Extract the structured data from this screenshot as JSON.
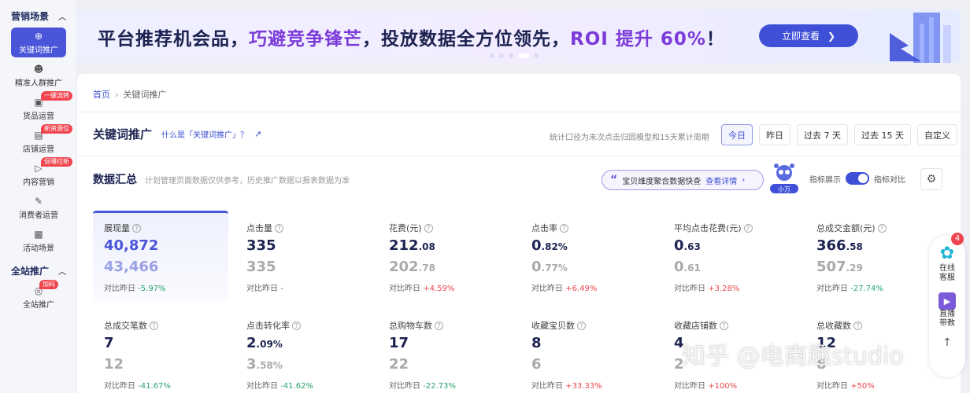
{
  "sidebar": {
    "group1": "营销场景",
    "items": [
      {
        "label": "关键词推广",
        "icon": "target-icon",
        "active": true,
        "badge": ""
      },
      {
        "label": "精准人群推广",
        "icon": "user-icon",
        "active": false,
        "badge": ""
      },
      {
        "label": "货品运营",
        "icon": "goods-icon",
        "active": false,
        "badge": "一键流转"
      },
      {
        "label": "店铺运营",
        "icon": "shop-icon",
        "active": false,
        "badge": "新资源位"
      },
      {
        "label": "内容营销",
        "icon": "content-icon",
        "active": false,
        "badge": "促曝拉新"
      },
      {
        "label": "消费者运营",
        "icon": "consumer-icon",
        "active": false,
        "badge": ""
      },
      {
        "label": "活动场景",
        "icon": "activity-icon",
        "active": false,
        "badge": ""
      }
    ],
    "group2": "全站推广",
    "items2": [
      {
        "label": "全站推广",
        "icon": "site-icon",
        "badge": "加码"
      }
    ]
  },
  "banner": {
    "text_part1": "平台推荐机会品，",
    "text_hl1": "巧避竞争锋芒",
    "text_part2": "，投放数据全方位领先，",
    "text_hl2": "ROI 提升 60%",
    "text_part3": "！",
    "button": "立即查看"
  },
  "breadcrumb": {
    "home": "首页",
    "current": "关键词推广"
  },
  "page": {
    "title": "关键词推广",
    "what_link": "什么是「关键词推广」？",
    "stat_note": "统计口径为末次点击归因模型和15天累计周期"
  },
  "date_tabs": [
    "今日",
    "昨日",
    "过去 7 天",
    "过去 15 天",
    "自定义"
  ],
  "summary": {
    "title": "数据汇总",
    "desc": "计划管理页面数据仅供参考，历史推广数据以报表数据为准",
    "promo": "宝贝维度聚合数据快查",
    "promo_detail": "查看详情",
    "robot_label": "小万",
    "toggle1": "指标展示",
    "toggle2": "指标对比"
  },
  "metrics": [
    {
      "label": "展现量",
      "main": "40,872",
      "main_dec": "",
      "prev": "43,466",
      "prev_dec": "",
      "cmp_label": "对比昨日",
      "cmp": "-5.97%",
      "dir": "down"
    },
    {
      "label": "点击量",
      "main": "335",
      "main_dec": "",
      "prev": "335",
      "prev_dec": "",
      "cmp_label": "对比昨日",
      "cmp": "-",
      "dir": "none"
    },
    {
      "label": "花费(元)",
      "main": "212",
      "main_dec": ".08",
      "prev": "202",
      "prev_dec": ".78",
      "cmp_label": "对比昨日",
      "cmp": "+4.59%",
      "dir": "up"
    },
    {
      "label": "点击率",
      "main": "0",
      "main_dec": ".82%",
      "prev": "0",
      "prev_dec": ".77%",
      "cmp_label": "对比昨日",
      "cmp": "+6.49%",
      "dir": "up"
    },
    {
      "label": "平均点击花费(元)",
      "main": "0",
      "main_dec": ".63",
      "prev": "0",
      "prev_dec": ".61",
      "cmp_label": "对比昨日",
      "cmp": "+3.28%",
      "dir": "up"
    },
    {
      "label": "总成交金额(元)",
      "main": "366",
      "main_dec": ".58",
      "prev": "507",
      "prev_dec": ".29",
      "cmp_label": "对比昨日",
      "cmp": "-27.74%",
      "dir": "down"
    },
    {
      "label": "总成交笔数",
      "main": "7",
      "main_dec": "",
      "prev": "12",
      "prev_dec": "",
      "cmp_label": "对比昨日",
      "cmp": "-41.67%",
      "dir": "down"
    },
    {
      "label": "点击转化率",
      "main": "2",
      "main_dec": ".09%",
      "prev": "3",
      "prev_dec": ".58%",
      "cmp_label": "对比昨日",
      "cmp": "-41.62%",
      "dir": "down"
    },
    {
      "label": "总购物车数",
      "main": "17",
      "main_dec": "",
      "prev": "22",
      "prev_dec": "",
      "cmp_label": "对比昨日",
      "cmp": "-22.73%",
      "dir": "down"
    },
    {
      "label": "收藏宝贝数",
      "main": "8",
      "main_dec": "",
      "prev": "6",
      "prev_dec": "",
      "cmp_label": "对比昨日",
      "cmp": "+33.33%",
      "dir": "up"
    },
    {
      "label": "收藏店铺数",
      "main": "4",
      "main_dec": "",
      "prev": "2",
      "prev_dec": "",
      "cmp_label": "对比昨日",
      "cmp": "+100%",
      "dir": "up"
    },
    {
      "label": "总收藏数",
      "main": "12",
      "main_dec": "",
      "prev": "8",
      "prev_dec": "",
      "cmp_label": "对比昨日",
      "cmp": "+50%",
      "dir": "up"
    }
  ],
  "service": {
    "badge": "4",
    "label1": "在线客服",
    "label2": "直播带教"
  },
  "watermark": "知乎 @电商趣studio",
  "colors": {
    "accent": "#4a55d9",
    "up": "#e8474c",
    "down": "#28a36a",
    "badge": "#f0454f"
  }
}
